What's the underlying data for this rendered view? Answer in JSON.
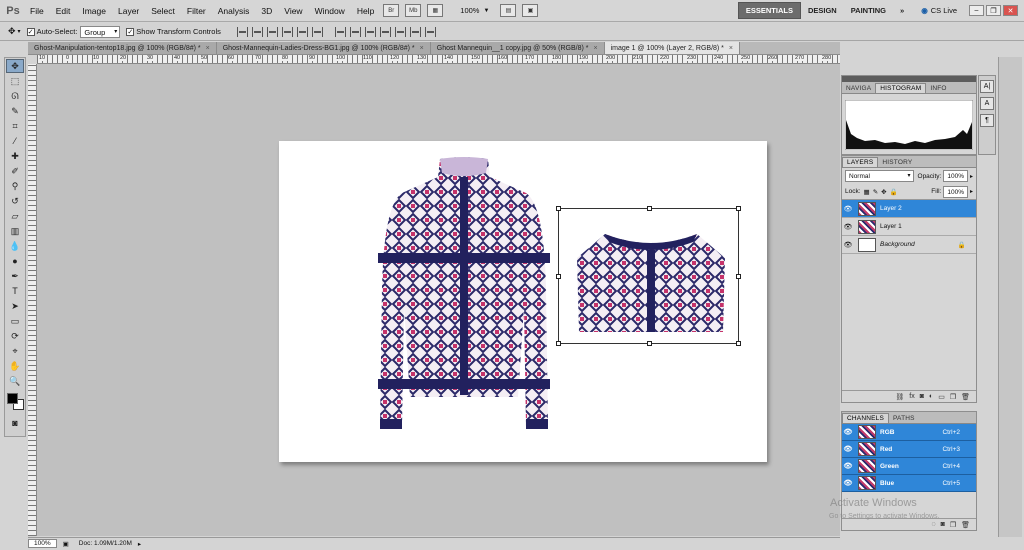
{
  "menubar": {
    "logo": "Ps",
    "items": [
      "File",
      "Edit",
      "Image",
      "Layer",
      "Select",
      "Filter",
      "Analysis",
      "3D",
      "View",
      "Window",
      "Help"
    ],
    "icon_br": "Br",
    "icon_mb": "Mb",
    "zoom": "100%",
    "workspaces": [
      "ESSENTIALS",
      "DESIGN",
      "PAINTING"
    ],
    "more": "»",
    "cslive": "CS Live"
  },
  "options": {
    "auto_select_label": "Auto-Select:",
    "auto_select_value": "Group",
    "show_transform_label": "Show Transform Controls"
  },
  "tabs": [
    {
      "label": "Ghost-Manipulation-tentop18.jpg @ 100% (RGB/8#) *"
    },
    {
      "label": "Ghost-Mannequin-Ladies-Dress-BG1.jpg @ 100% (RGB/8#) *"
    },
    {
      "label": "Ghost Mannequin__1 copy.jpg @ 50% (RGB/8) *"
    },
    {
      "label": "image 1 @ 100% (Layer 2, RGB/8) *"
    }
  ],
  "ruler_top_numbers": [
    "10",
    "0",
    "10",
    "20",
    "30",
    "40",
    "50",
    "60",
    "70",
    "80",
    "90",
    "100",
    "110",
    "120",
    "130",
    "140",
    "150",
    "160",
    "170",
    "180",
    "190",
    "200",
    "210",
    "220",
    "230",
    "240",
    "250",
    "260",
    "270",
    "280"
  ],
  "status": {
    "zoom": "100%",
    "doc": "Doc: 1.09M/1.20M"
  },
  "histogram_panel": {
    "tabs": [
      "NAVIGA",
      "HISTOGRAM",
      "INFO"
    ]
  },
  "layers_panel": {
    "tabs": [
      "LAYERS",
      "HISTORY"
    ],
    "blend_mode": "Normal",
    "opacity_label": "Opacity:",
    "opacity_value": "100%",
    "lock_label": "Lock:",
    "fill_label": "Fill:",
    "fill_value": "100%",
    "layers": [
      {
        "name": "Layer 2",
        "active": true
      },
      {
        "name": "Layer 1",
        "active": false
      },
      {
        "name": "Background",
        "active": false
      }
    ]
  },
  "channels_panel": {
    "tabs": [
      "CHANNELS",
      "PATHS"
    ],
    "channels": [
      {
        "name": "RGB",
        "key": "Ctrl+2"
      },
      {
        "name": "Red",
        "key": "Ctrl+3"
      },
      {
        "name": "Green",
        "key": "Ctrl+4"
      },
      {
        "name": "Blue",
        "key": "Ctrl+5"
      }
    ]
  },
  "watermark": {
    "title": "Activate Windows",
    "sub": "Go to Settings to activate Windows."
  }
}
